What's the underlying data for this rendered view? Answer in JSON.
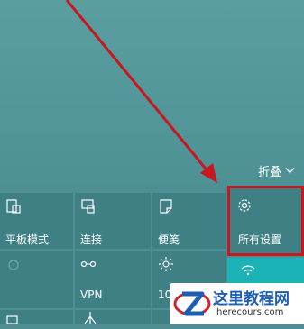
{
  "action_center": {
    "collapse_label": "折叠",
    "collapse_icon": "chevron-down-icon",
    "tiles": [
      {
        "label": "平板模式",
        "icon": "tablet-mode-icon"
      },
      {
        "label": "连接",
        "icon": "connect-icon"
      },
      {
        "label": "便笺",
        "icon": "note-icon"
      },
      {
        "label": "所有设置",
        "icon": "gear-icon"
      },
      {
        "label": "",
        "icon": "location-icon"
      },
      {
        "label": "VPN",
        "icon": "vpn-icon"
      },
      {
        "label": "10",
        "icon": "brightness-icon"
      },
      {
        "label": "",
        "icon": "wifi-icon"
      },
      {
        "label": "",
        "icon": "battery-saver-icon"
      },
      {
        "label": "",
        "icon": "network-icon"
      }
    ]
  },
  "annotation": {
    "color": "#c8171e"
  },
  "watermark": {
    "title": "这里教程网",
    "url": "herecours.com"
  },
  "colors": {
    "background": "#4f8f93",
    "tile": "#3f8084",
    "tile_active": "#1bb3b5"
  }
}
